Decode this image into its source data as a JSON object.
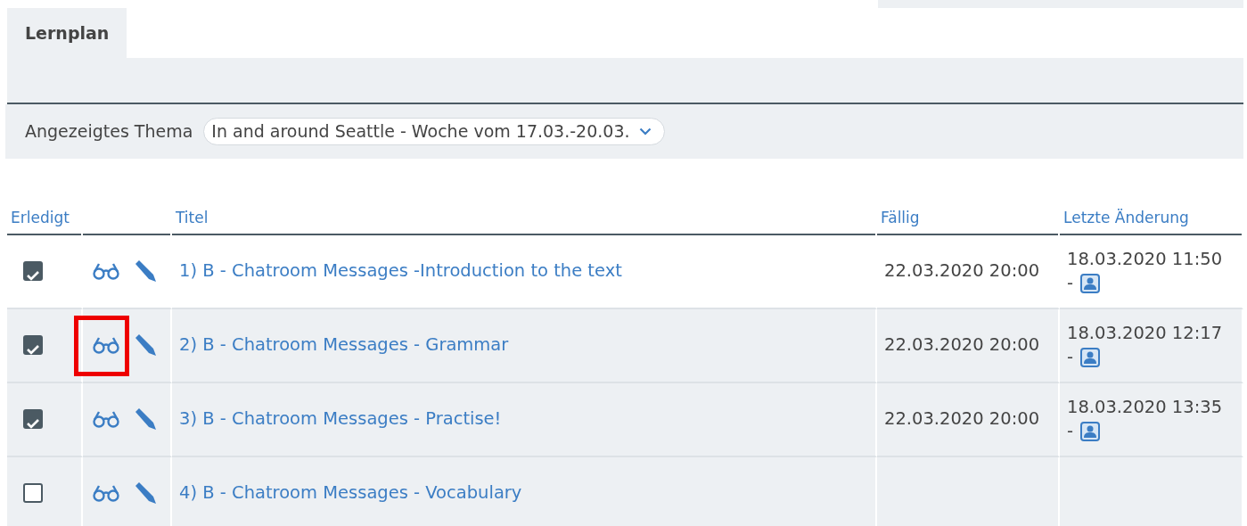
{
  "tabs": [
    {
      "label": "Lernplan",
      "selected": true
    }
  ],
  "filter": {
    "label": "Angezeigtes Thema",
    "value": "In and around Seattle - Woche vom 17.03.-20.03."
  },
  "table": {
    "columns": [
      "Erledigt",
      "",
      "Titel",
      "Fällig",
      "Letzte Änderung"
    ],
    "rows": [
      {
        "done": true,
        "shaded": false,
        "highlighted": false,
        "title": "1) B - Chatroom Messages -Introduction to the text",
        "due": "22.03.2020 20:00",
        "changed": "18.03.2020 11:50",
        "changed_suffix": "-"
      },
      {
        "done": true,
        "shaded": true,
        "highlighted": true,
        "title": "2) B - Chatroom Messages - Grammar",
        "due": "22.03.2020 20:00",
        "changed": "18.03.2020 12:17",
        "changed_suffix": "-"
      },
      {
        "done": true,
        "shaded": true,
        "highlighted": false,
        "title": "3) B - Chatroom Messages - Practise!",
        "due": "22.03.2020 20:00",
        "changed": "18.03.2020 13:35",
        "changed_suffix": "-"
      },
      {
        "done": false,
        "shaded": true,
        "highlighted": false,
        "title": "4) B - Chatroom Messages - Vocabulary"
      }
    ]
  }
}
